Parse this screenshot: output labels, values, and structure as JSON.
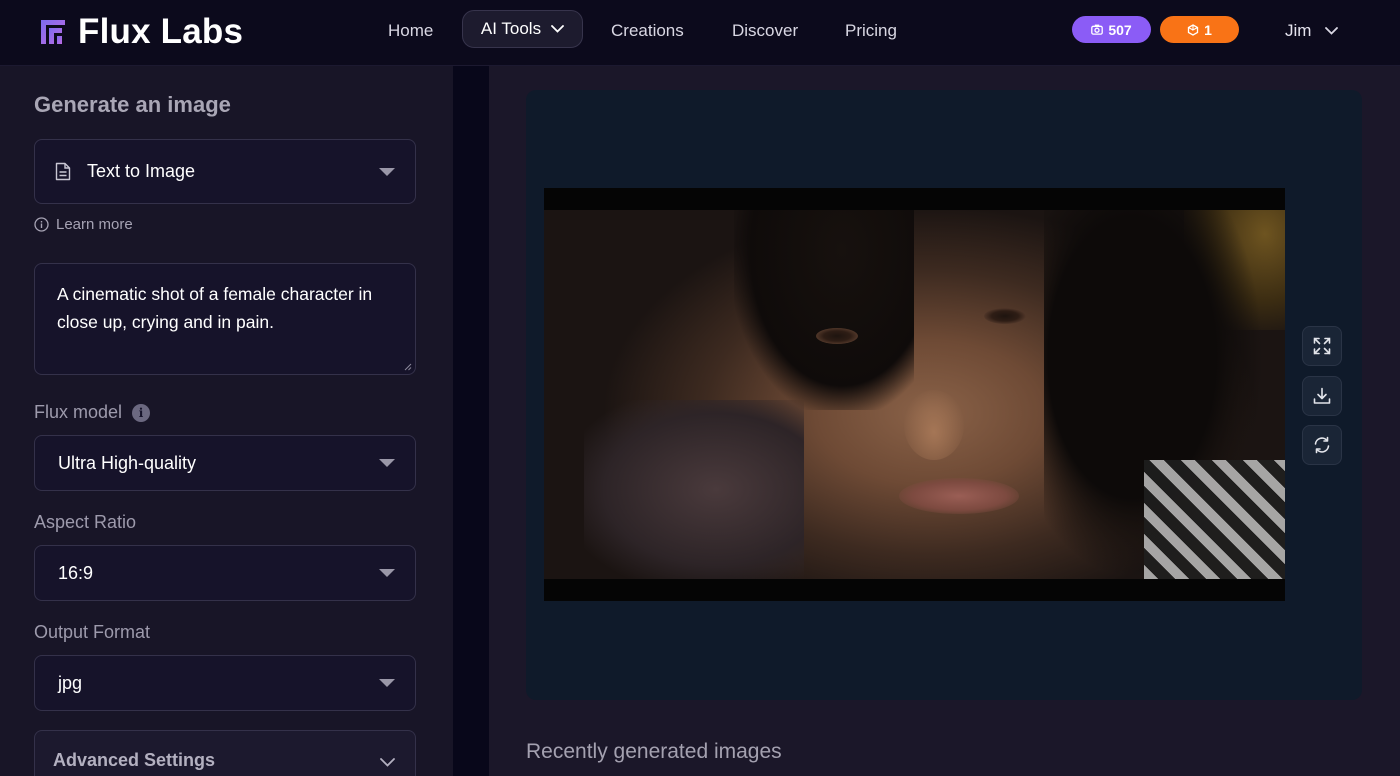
{
  "header": {
    "brand": "Flux Labs",
    "nav": [
      "Home",
      "AI Tools",
      "Creations",
      "Discover",
      "Pricing"
    ],
    "credits_purple": "507",
    "credits_orange": "1",
    "user_name": "Jim"
  },
  "sidebar": {
    "title": "Generate an image",
    "mode_value": "Text to Image",
    "learn_more": "Learn more",
    "prompt": "A cinematic shot of a female character in close up, crying and in pain.",
    "model_label": "Flux model",
    "model_value": "Ultra High-quality",
    "aspect_label": "Aspect Ratio",
    "aspect_value": "16:9",
    "format_label": "Output Format",
    "format_value": "jpg",
    "advanced_label": "Advanced Settings"
  },
  "main": {
    "recent_heading": "Recently generated images"
  },
  "colors": {
    "accent_purple": "#8b5cf6",
    "accent_orange": "#f97316",
    "background": "#0f0c1f",
    "panel": "#181527",
    "preview_bg": "#0f1a2a"
  },
  "icons": [
    "logo-icon",
    "chevron-down-icon",
    "camera-icon",
    "coin-icon",
    "document-icon",
    "info-icon",
    "expand-icon",
    "download-icon",
    "refresh-icon"
  ]
}
